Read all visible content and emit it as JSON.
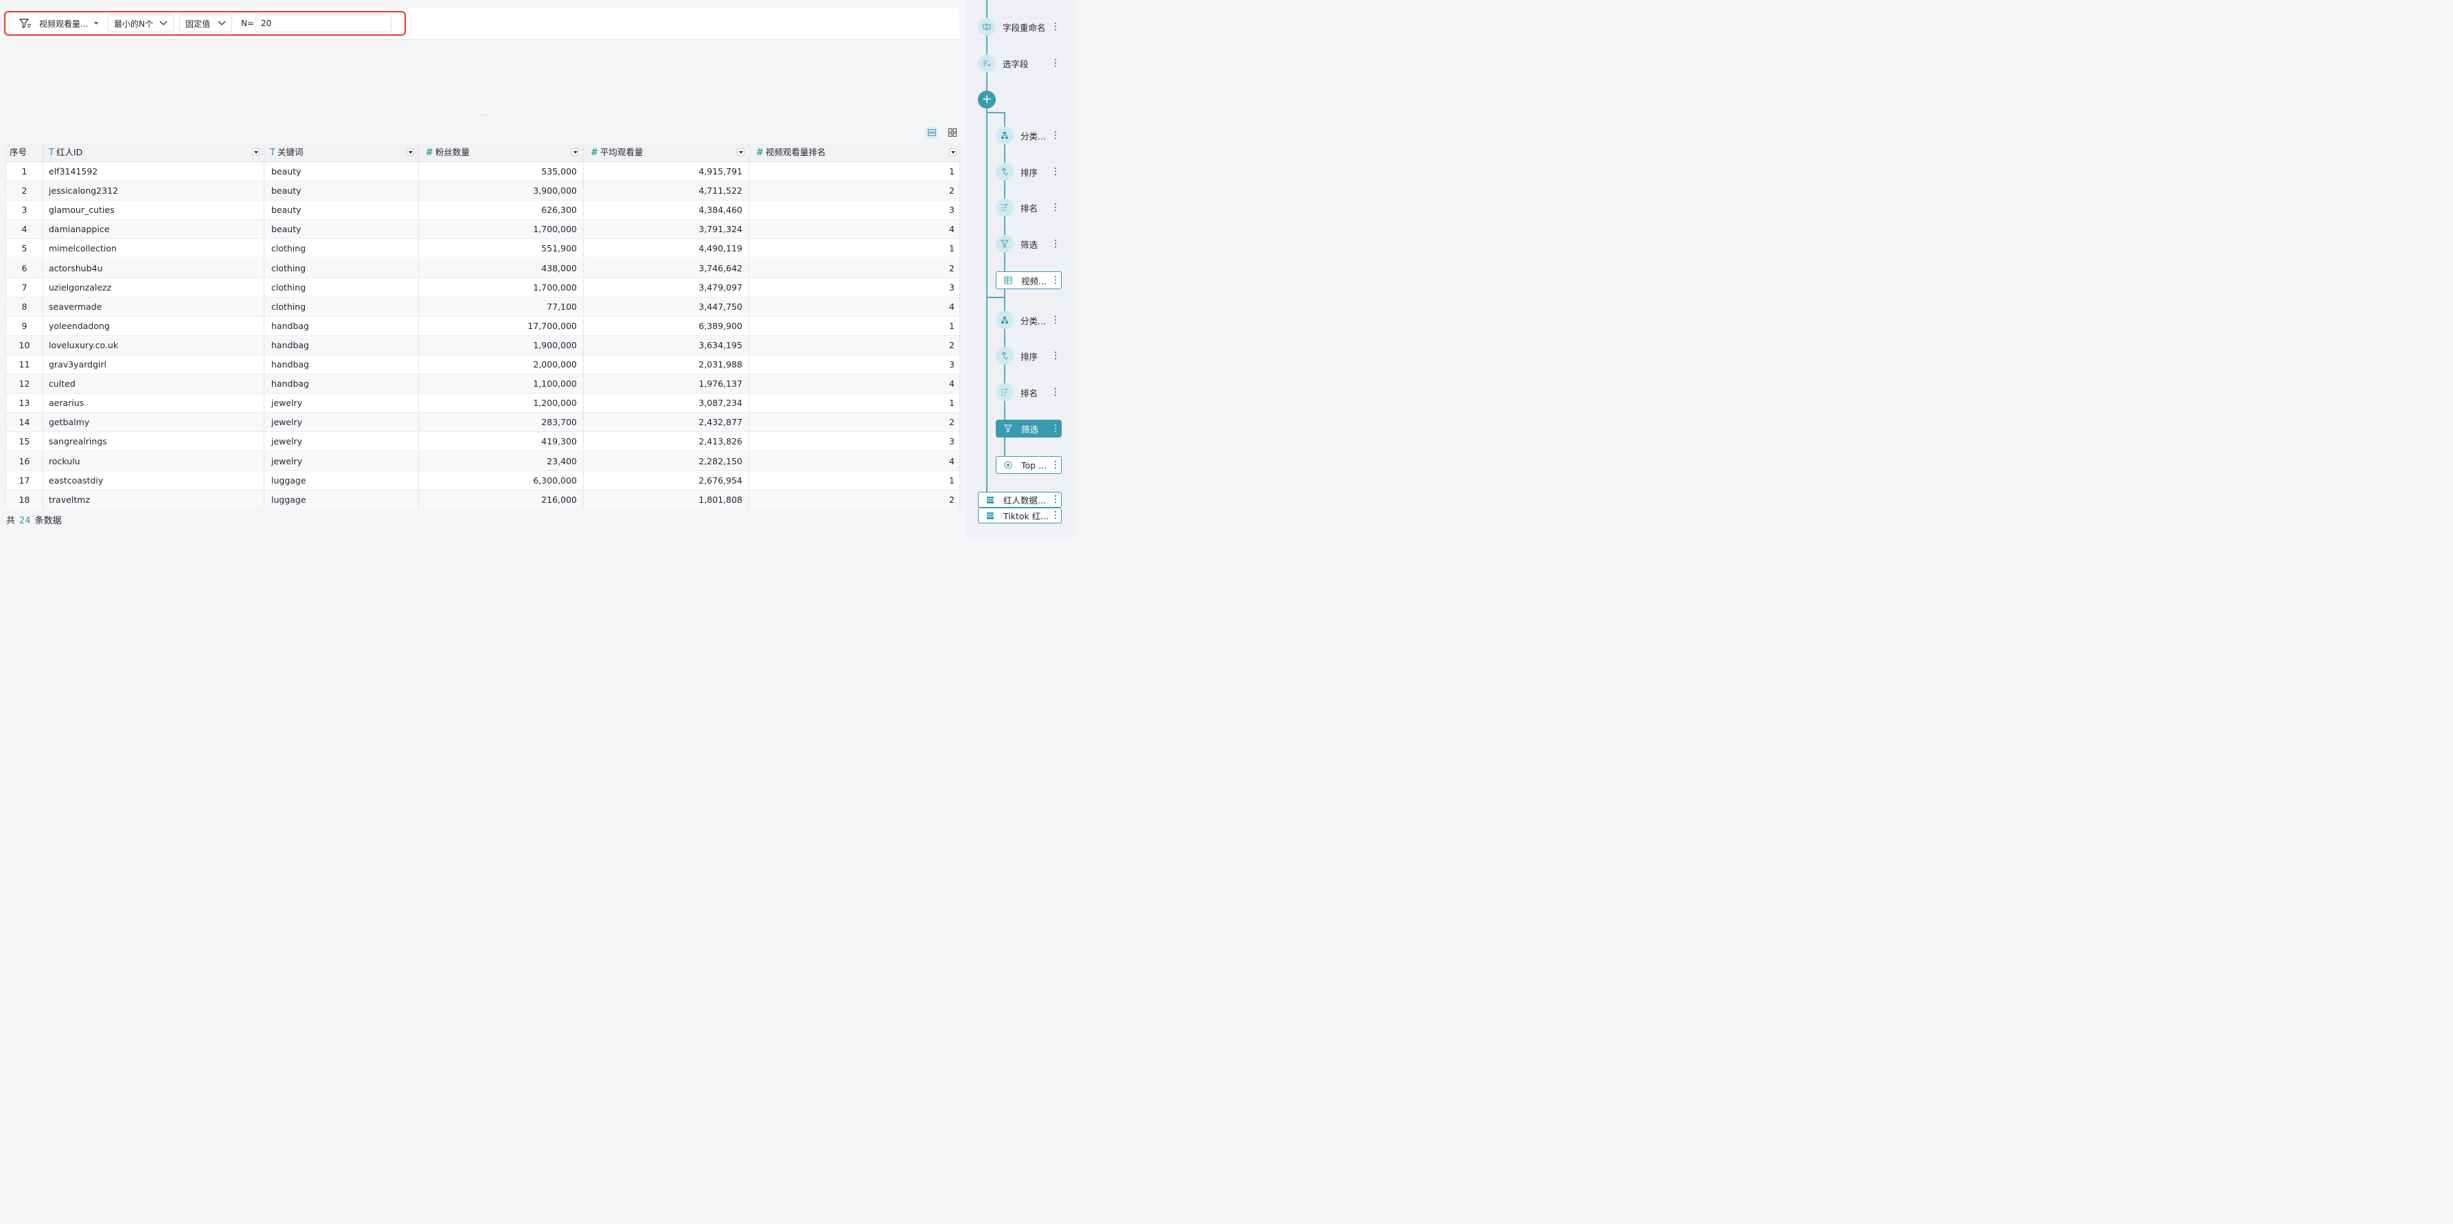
{
  "toolbar": {
    "field_select": "视频观看量...",
    "mode_select": "最小的N个",
    "value_type_select": "固定值",
    "n_label": "N=",
    "n_value": "20"
  },
  "splitter_text": "...",
  "table": {
    "columns": [
      {
        "label": "序号",
        "type": "none"
      },
      {
        "label": "红人ID",
        "type": "text"
      },
      {
        "label": "关键词",
        "type": "text"
      },
      {
        "label": "粉丝数量",
        "type": "number"
      },
      {
        "label": "平均观看量",
        "type": "number"
      },
      {
        "label": "视频观看量排名",
        "type": "number"
      }
    ],
    "rows": [
      [
        "1",
        "elf3141592",
        "beauty",
        "535,000",
        "4,915,791",
        "1"
      ],
      [
        "2",
        "jessicalong2312",
        "beauty",
        "3,900,000",
        "4,711,522",
        "2"
      ],
      [
        "3",
        "glamour_cuties",
        "beauty",
        "626,300",
        "4,384,460",
        "3"
      ],
      [
        "4",
        "damianappice",
        "beauty",
        "1,700,000",
        "3,791,324",
        "4"
      ],
      [
        "5",
        "mimelcollection",
        "clothing",
        "551,900",
        "4,490,119",
        "1"
      ],
      [
        "6",
        "actorshub4u",
        "clothing",
        "438,000",
        "3,746,642",
        "2"
      ],
      [
        "7",
        "uzielgonzalezz",
        "clothing",
        "1,700,000",
        "3,479,097",
        "3"
      ],
      [
        "8",
        "seavermade",
        "clothing",
        "77,100",
        "3,447,750",
        "4"
      ],
      [
        "9",
        "yoleendadong",
        "handbag",
        "17,700,000",
        "6,389,900",
        "1"
      ],
      [
        "10",
        "loveluxury.co.uk",
        "handbag",
        "1,900,000",
        "3,634,195",
        "2"
      ],
      [
        "11",
        "grav3yardgirl",
        "handbag",
        "2,000,000",
        "2,031,988",
        "3"
      ],
      [
        "12",
        "culted",
        "handbag",
        "1,100,000",
        "1,976,137",
        "4"
      ],
      [
        "13",
        "aerarius",
        "jewelry",
        "1,200,000",
        "3,087,234",
        "1"
      ],
      [
        "14",
        "getbalmy",
        "jewelry",
        "283,700",
        "2,432,877",
        "2"
      ],
      [
        "15",
        "sangrealrings",
        "jewelry",
        "419,300",
        "2,413,826",
        "3"
      ],
      [
        "16",
        "rockulu",
        "jewelry",
        "23,400",
        "2,282,150",
        "4"
      ],
      [
        "17",
        "eastcoastdiy",
        "luggage",
        "6,300,000",
        "2,676,954",
        "1"
      ],
      [
        "18",
        "traveltmz",
        "luggage",
        "216,000",
        "1,801,808",
        "2"
      ]
    ]
  },
  "footer": {
    "prefix": "共",
    "count": "24",
    "suffix": "条数据"
  },
  "sidebar": {
    "nodes": [
      {
        "label": "字段重命名",
        "icon": "rename-icon"
      },
      {
        "label": "选字段",
        "icon": "select-fields-icon"
      },
      {
        "label": "分类...",
        "icon": "group-icon"
      },
      {
        "label": "排序",
        "icon": "sort-icon"
      },
      {
        "label": "排名",
        "icon": "rank-icon"
      },
      {
        "label": "筛选",
        "icon": "filter-icon"
      },
      {
        "label": "视频...",
        "icon": "table-icon"
      },
      {
        "label": "分类...",
        "icon": "group-icon"
      },
      {
        "label": "排序",
        "icon": "sort-icon"
      },
      {
        "label": "排名",
        "icon": "rank-icon"
      },
      {
        "label": "筛选",
        "icon": "filter-icon"
      },
      {
        "label": "Top ...",
        "icon": "output-icon"
      },
      {
        "label": "红人数据...",
        "icon": "dataset-icon"
      },
      {
        "label": "Tiktok 红...",
        "icon": "dataset-icon"
      }
    ]
  },
  "colors": {
    "accent": "#3a9ab0",
    "highlight_border": "#e53b30",
    "number_icon": "#2ea58a",
    "text_icon": "#3a86d4"
  }
}
